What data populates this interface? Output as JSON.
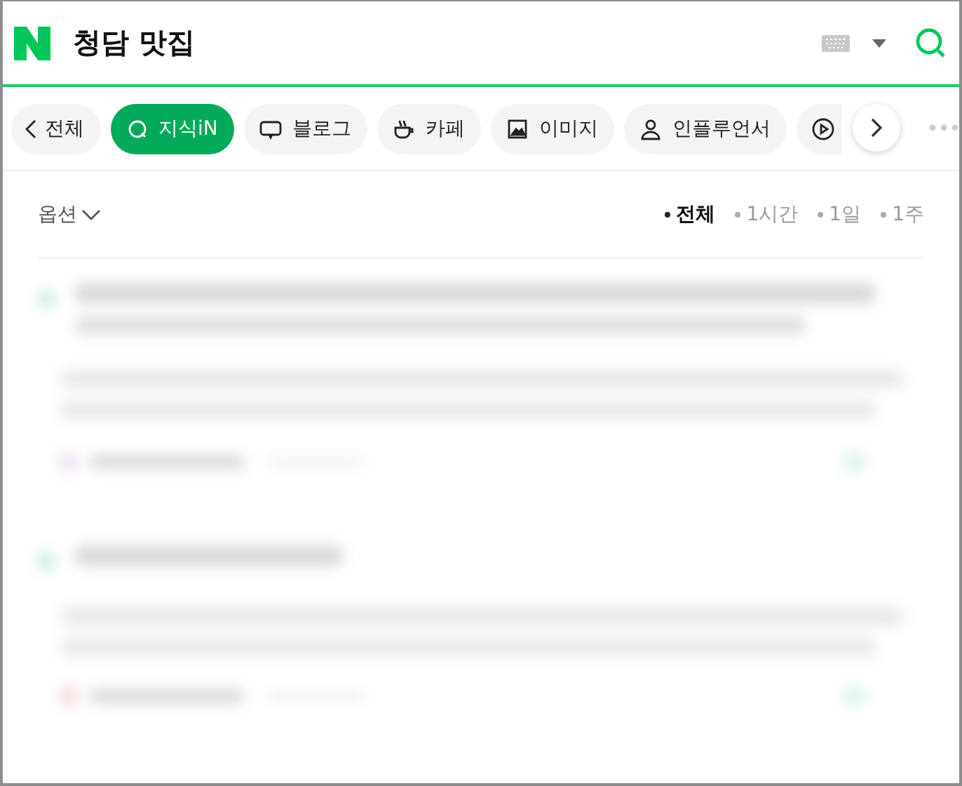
{
  "search": {
    "query": "청담 맛집"
  },
  "tabs": [
    {
      "label": "전체",
      "selected": false
    },
    {
      "label": "지식iN",
      "selected": true
    },
    {
      "label": "블로그",
      "selected": false
    },
    {
      "label": "카페",
      "selected": false
    },
    {
      "label": "이미지",
      "selected": false
    },
    {
      "label": "인플루언서",
      "selected": false
    },
    {
      "selected": false
    }
  ],
  "options": {
    "label": "옵션"
  },
  "time_filters": [
    {
      "label": "전체",
      "selected": true
    },
    {
      "label": "1시간",
      "selected": false
    },
    {
      "label": "1일",
      "selected": false
    },
    {
      "label": "1주",
      "selected": false
    }
  ]
}
